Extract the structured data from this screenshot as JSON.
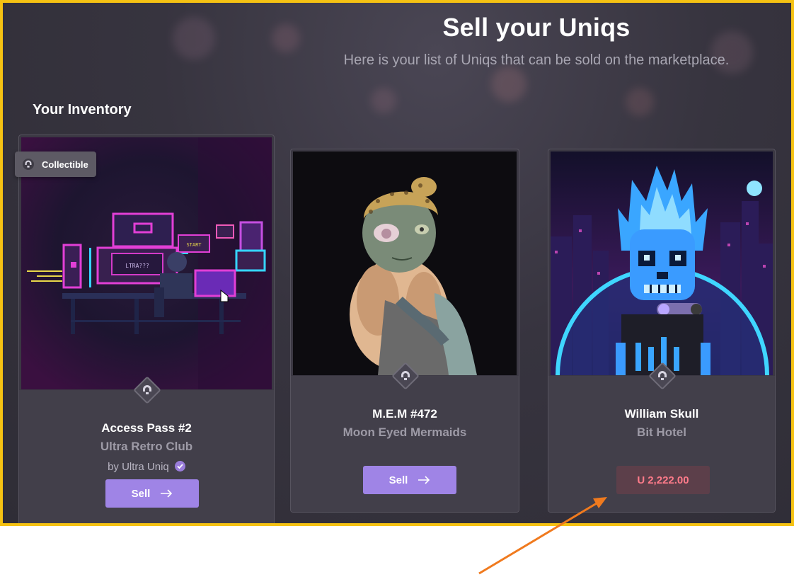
{
  "header": {
    "title": "Sell your Uniqs",
    "subtitle": "Here is your list of Uniqs that can be sold on the marketplace."
  },
  "inventory": {
    "heading": "Your Inventory"
  },
  "cards": [
    {
      "name": "Access Pass #2",
      "collection": "Ultra Retro Club",
      "creator_prefix": "by",
      "creator": "Ultra Uniq",
      "badge": "Collectible",
      "action_label": "Sell"
    },
    {
      "name": "M.E.M #472",
      "collection": "Moon Eyed Mermaids",
      "action_label": "Sell"
    },
    {
      "name": "William Skull",
      "collection": "Bit Hotel",
      "currency_symbol": "U",
      "price": "2,222.00"
    }
  ],
  "colors": {
    "highlight_border": "#f5c213",
    "accent": "#9f84e6",
    "price_text": "#ff7b8a",
    "annotation_arrow": "#f07a1e"
  },
  "icons": {
    "uniq": "uniq-logo-icon",
    "arrow": "arrow-right-icon",
    "verified": "verified-check-icon"
  }
}
